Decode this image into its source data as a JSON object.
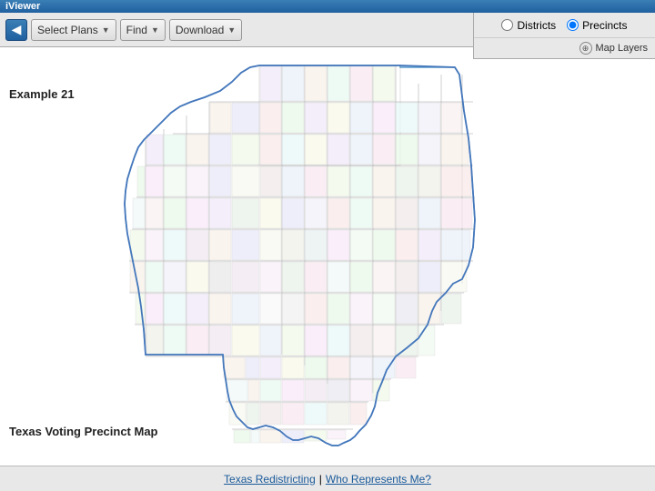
{
  "header": {
    "title": "iViewer"
  },
  "toolbar": {
    "back_arrow": "◀",
    "select_plans_label": "Select Plans",
    "find_label": "Find",
    "download_label": "Download"
  },
  "controls": {
    "districts_label": "Districts",
    "precincts_label": "Precincts",
    "map_layers_label": "Map Layers",
    "districts_checked": false,
    "precincts_checked": true
  },
  "map": {
    "example_label": "Example 21",
    "map_label": "Texas Voting Precinct Map"
  },
  "footer": {
    "redistricting_label": "Texas Redistricting",
    "separator": "|",
    "who_represents_label": "Who Represents Me?"
  }
}
